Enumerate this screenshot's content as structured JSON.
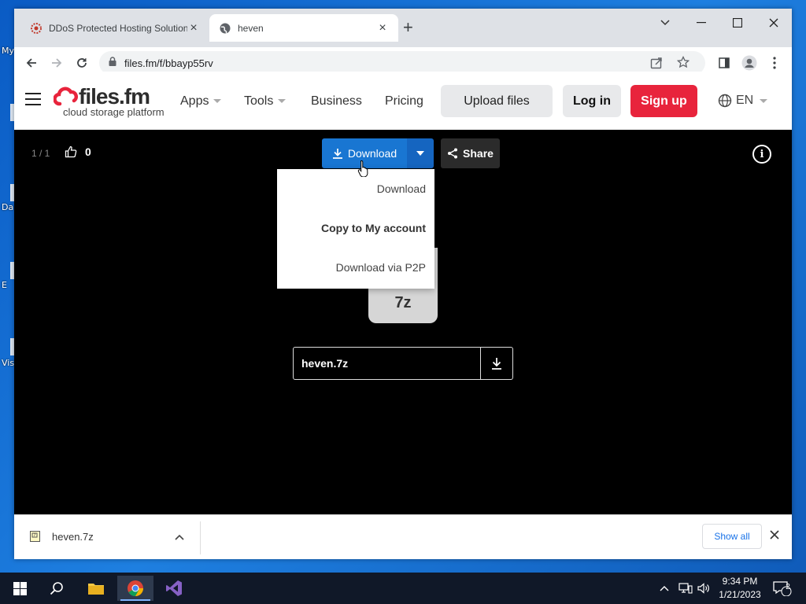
{
  "desktop": {
    "labels": [
      "My",
      "Da",
      "E",
      "Vis"
    ]
  },
  "browser": {
    "tabs": [
      {
        "title": "DDoS Protected Hosting Solution",
        "close": "×"
      },
      {
        "title": "heven",
        "close": "×"
      }
    ],
    "new_tab": "+",
    "url": "files.fm/f/bbayp55rv"
  },
  "site": {
    "logo": {
      "main": "files.fm",
      "sub": "cloud storage platform"
    },
    "nav": {
      "apps": "Apps",
      "tools": "Tools",
      "business": "Business",
      "pricing": "Pricing"
    },
    "upload": "Upload files",
    "login": "Log in",
    "signup": "Sign up",
    "lang": "EN"
  },
  "viewer": {
    "counter": "1 / 1",
    "likes": "0",
    "download": "Download",
    "share": "Share",
    "info": "i",
    "file_ext": "7z",
    "file_name": "heven.7z",
    "menu": [
      "Download",
      "Copy to My account",
      "Download via P2P"
    ]
  },
  "download_shelf": {
    "file": "heven.7z",
    "show_all": "Show all"
  },
  "taskbar": {
    "time": "9:34 PM",
    "date": "1/21/2023",
    "notifications": "2"
  },
  "colors": {
    "accent_blue": "#1976d2",
    "signup_red": "#e8243c",
    "logo_red": "#e8243c"
  }
}
